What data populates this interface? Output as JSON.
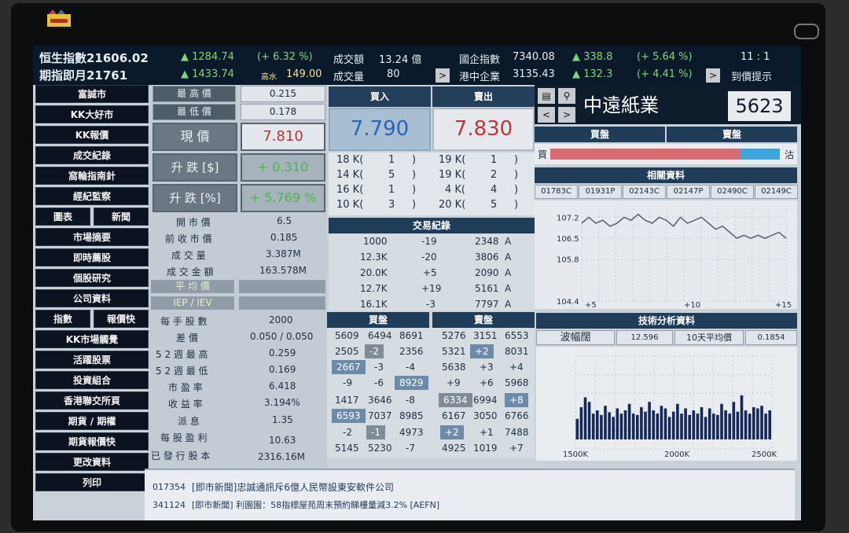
{
  "top": {
    "hsi_label": "恒生指數21606.02",
    "hsi_change": "▲ 1284.74",
    "hsi_pct": "(+ 6.32 %)",
    "turnover_label": "成交額",
    "turnover_value": "13.24  億",
    "hscei_label": "國企指數",
    "hscei_value": "7340.08",
    "hscei_change": "▲ 338.8",
    "hscei_pct": "(+ 5.64 %)",
    "time": "11 : 1",
    "fut_label": "期指即月21761",
    "fut_change": "▲ 1433.74",
    "fut_premium_label": "高水",
    "fut_premium_value": "149.00",
    "volume_label": "成交量",
    "volume_value": "80",
    "redchip_label": "港中企業",
    "redchip_value": "3135.43",
    "redchip_change": "▲ 132.3",
    "redchip_pct": "(+ 4.41 %)",
    "alert_label": "到價提示",
    "arrow": ">"
  },
  "menu": [
    "富誠市",
    "KK大好市",
    "KK報價",
    "成交紀錄",
    "窩輪指南針",
    "經紀監察",
    "圖表",
    "新聞",
    "市場摘要",
    "即時薦股",
    "個股研究",
    "公司資料",
    "指數",
    "報價快",
    "KK市場觸覺",
    "活躍股票",
    "投資組合",
    "香港聯交所頁",
    "期貨 / 期權",
    "期貨報價快",
    "更改資料",
    "列印"
  ],
  "quote": {
    "high_label": "最 高 價",
    "high_value": "0.215",
    "low_label": "最 低 價",
    "low_value": "0.178",
    "price_label": "現 價",
    "price_value": "7.810",
    "chg_label": "升 跌 [$]",
    "chg_value": "+ 0.310",
    "pct_label": "升 跌 [%]",
    "pct_value": "+ 5.769 %",
    "stats": [
      [
        "開 市 價",
        "6.5"
      ],
      [
        "前 收 市 價",
        "0.185"
      ],
      [
        "成 交 量",
        "3.387M"
      ],
      [
        "成 交 金 額",
        "163.578M"
      ]
    ],
    "avg_label": "平 均 價",
    "iep_label": "IEP / IEV",
    "stats2": [
      [
        "每 手 股 數",
        "2000"
      ],
      [
        "差 價",
        "0.050 / 0.050"
      ],
      [
        "5 2 週 最 高",
        "0.259"
      ],
      [
        "5 2 週 最 低",
        "0.169"
      ],
      [
        "市 盈 率",
        "6.418"
      ],
      [
        "收 益 率",
        "3.194%"
      ],
      [
        "派 息",
        "1.35"
      ],
      [
        "每 股 盈 利",
        "10.63"
      ],
      [
        "已 發 行 股 本",
        "2316.16M"
      ]
    ]
  },
  "order": {
    "bid_label": "買入",
    "ask_label": "賣出",
    "bid": "7.790",
    "ask": "7.830",
    "bid_queue": [
      [
        "18 K(",
        "1",
        ")"
      ],
      [
        "14 K(",
        "5",
        ")"
      ],
      [
        "16 K(",
        "1",
        ")"
      ],
      [
        "10 K(",
        "3",
        ")"
      ]
    ],
    "ask_queue": [
      [
        "19 K(",
        "1",
        ")"
      ],
      [
        "19 K(",
        "2",
        ")"
      ],
      [
        "4 K(",
        "4",
        ")"
      ],
      [
        "20 K(",
        "5",
        ")"
      ]
    ]
  },
  "trades": {
    "title": "交易紀錄",
    "rows": [
      [
        "1000",
        "-19",
        "2348",
        "A"
      ],
      [
        "12.3K",
        "-20",
        "3806",
        "A"
      ],
      [
        "20.0K",
        "+5",
        "2090",
        "A"
      ],
      [
        "12.7K",
        "+19",
        "5161",
        "A"
      ],
      [
        "16.1K",
        "-3",
        "7797",
        "A"
      ]
    ]
  },
  "book": {
    "buy_label": "買盤",
    "sell_label": "賣盤",
    "buy": [
      [
        "5609",
        "6494",
        "8691"
      ],
      [
        "2505",
        "-2",
        "2356"
      ],
      [
        "2667",
        "-3",
        "-4"
      ],
      [
        "-9",
        "-6",
        "8929"
      ],
      [
        "1417",
        "3646",
        "-8"
      ],
      [
        "6593",
        "7037",
        "8985"
      ],
      [
        "-2",
        "-1",
        "4973"
      ],
      [
        "5145",
        "5230",
        "-7"
      ]
    ],
    "sell": [
      [
        "5276",
        "3151",
        "6553"
      ],
      [
        "5321",
        "+2",
        "8031"
      ],
      [
        "5638",
        "+3",
        "+4"
      ],
      [
        "+9",
        "+6",
        "5968"
      ],
      [
        "6334",
        "6994",
        "+8"
      ],
      [
        "6167",
        "3050",
        "6766"
      ],
      [
        "+2",
        "+1",
        "7488"
      ],
      [
        "4925",
        "1019",
        "+7"
      ]
    ]
  },
  "stock": {
    "name": "中遠紙業",
    "code": "5623",
    "buy_label": "買盤",
    "sell_label": "賣盤",
    "bar_left": "買",
    "bar_right": "沽",
    "buy_ratio": 0.83,
    "related_title": "相關資料",
    "related": [
      "01783C",
      "01931P",
      "02143C",
      "02147P",
      "02490C",
      "02149C"
    ],
    "ta_title": "技術分析資料",
    "ta_label": "波幅闊",
    "ta_value": "12.596",
    "ma_label": "10天平均價",
    "ma_value": "0.1854"
  },
  "chart_data": [
    {
      "type": "line",
      "x": [
        1,
        2,
        3,
        4,
        5,
        6,
        7,
        8,
        9,
        10,
        11,
        12,
        13,
        14,
        15,
        16,
        17,
        18,
        19,
        20,
        21,
        22,
        23,
        24,
        25,
        26,
        27,
        28,
        29,
        30
      ],
      "values": [
        107.0,
        107.2,
        107.0,
        107.1,
        106.9,
        107.0,
        107.2,
        107.1,
        107.3,
        107.1,
        107.0,
        107.2,
        107.1,
        106.9,
        107.2,
        107.0,
        107.1,
        107.2,
        107.0,
        106.8,
        106.9,
        106.7,
        106.5,
        106.6,
        106.5,
        106.6,
        106.5,
        106.6,
        106.7,
        106.5
      ],
      "xticks": [
        "+5",
        "+10",
        "+15"
      ],
      "yticks": [
        "107.2",
        "106.5",
        "105.8",
        "104.4"
      ],
      "ylim": [
        104.4,
        107.5
      ]
    },
    {
      "type": "bar",
      "values": [
        22,
        40,
        55,
        48,
        30,
        35,
        28,
        42,
        32,
        25,
        38,
        30,
        35,
        45,
        30,
        28,
        40,
        33,
        48,
        35,
        30,
        42,
        38,
        25,
        33,
        45,
        30,
        38,
        28,
        35,
        30,
        40,
        25,
        38,
        30,
        28,
        45,
        35,
        30,
        48,
        33,
        58,
        35,
        30,
        40,
        38,
        42,
        30,
        35
      ],
      "xticks": [
        "1500K",
        "2000K",
        "2500K"
      ]
    }
  ],
  "news": [
    [
      "017354",
      "[即市新聞]忠誠通訊斥6億人民幣設東安軟件公司"
    ],
    [
      "341124",
      "[即市新聞] 利園園：58指標屋苑周末預約睇樓量減3.2% [AEFN]"
    ]
  ]
}
